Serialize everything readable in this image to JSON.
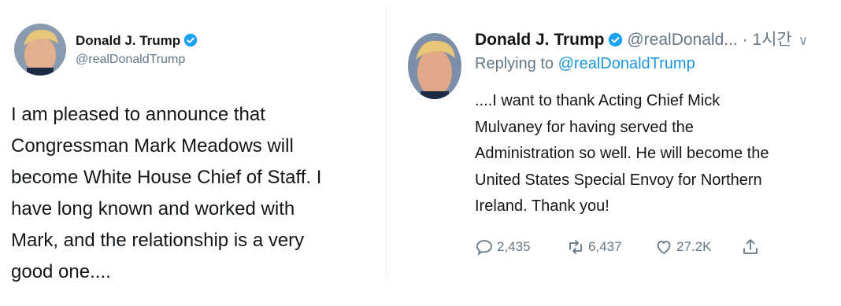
{
  "left_tweet": {
    "author_name": "Donald J. Trump",
    "handle": "@realDonaldTrump",
    "text": "I am pleased to announce that\nCongressman Mark Meadows will\nbecome White House Chief of Staff. I\nhave long known and worked with\nMark, and the relationship is a very\ngood one...."
  },
  "right_tweet": {
    "author_name": "Donald J. Trump",
    "handle_time": "@realDonald... · 1시간",
    "reply_prefix": "Replying to ",
    "reply_to": "@realDonaldTrump",
    "text": "....I want to thank Acting Chief Mick\nMulvaney for having served the\nAdministration so well. He will become the\nUnited States Special Envoy for Northern\nIreland. Thank you!",
    "actions": {
      "replies": "2,435",
      "retweets": "6,437",
      "likes": "27.2K"
    }
  },
  "colors": {
    "verified": "#1da1f2",
    "secondary_text": "#657786",
    "link": "#1b95e0"
  }
}
